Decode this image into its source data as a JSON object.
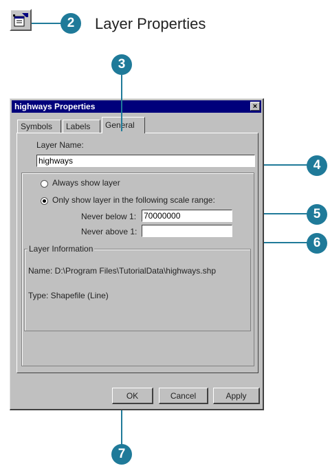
{
  "callouts": {
    "step2": "2",
    "step3": "3",
    "step4": "4",
    "step5": "5",
    "step6": "6",
    "step7": "7"
  },
  "step_title": "Layer Properties",
  "dialog": {
    "title": "highways Properties",
    "close": "×",
    "tabs": [
      {
        "label": "Symbols",
        "active": false
      },
      {
        "label": "Labels",
        "active": false
      },
      {
        "label": "General",
        "active": true
      }
    ],
    "layer_name_label": "Layer Name:",
    "layer_name_value": "highways",
    "radio_always": "Always show layer",
    "radio_range": "Only show layer in the following scale range:",
    "selected_radio": "range",
    "never_below_label": "Never below 1:",
    "never_below_value": "70000000",
    "never_above_label": "Never above 1:",
    "never_above_value": "",
    "layer_info_title": "Layer Information",
    "info_name": "Name: D:\\Program Files\\TutorialData\\highways.shp",
    "info_type": "Type:  Shapefile (Line)",
    "buttons": {
      "ok": "OK",
      "cancel": "Cancel",
      "apply": "Apply"
    }
  },
  "colors": {
    "callout": "#1f7a99",
    "titlebar": "#00007b",
    "dialog_bg": "#c0c0c0"
  },
  "icons": {
    "toolbar": "layer-properties-icon"
  }
}
